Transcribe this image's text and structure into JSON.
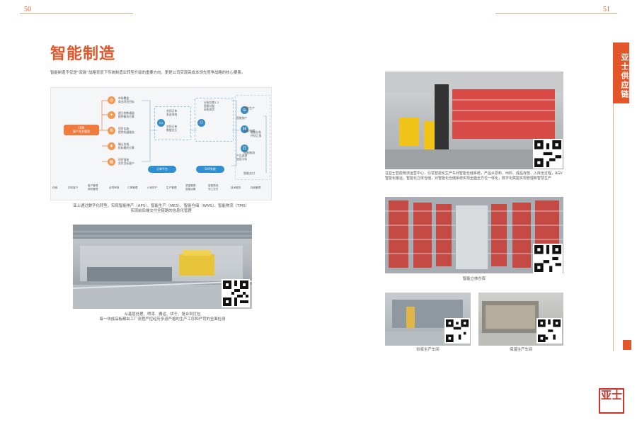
{
  "pages": {
    "left_number": "50",
    "right_number": "51"
  },
  "heading": "智能制造",
  "intro": "智能制造不仅是“双碳”战略背景下传统制造业转型升级的重要方向，更是公司实现高成本领先竞争战略的核心要素。",
  "diagram": {
    "crm": "CRM\n客户关系管理",
    "customer_items": [
      "市场覆盖\n商业项目目标",
      "建立销售通道\n提供解决方案",
      "项目实施\n提供机器服务",
      "确认实施\n投标最终方案",
      "项目落地\n交付目标客户"
    ],
    "middle_items": [
      "分配交期1-2\n智能分配\n采购发货",
      "合同订单\n发送系统",
      "合同订单\n数据交互"
    ],
    "right_items": [
      "智能排产",
      "数据分析\n评估汇报",
      "产品追溯\n加设分析"
    ],
    "outputs": [
      "智能生产",
      "智能仓储",
      "智能物流",
      "智能交付"
    ],
    "pill_left": "订单平台",
    "pill_right": "SAP系统",
    "flow": [
      "线索",
      "初访客户",
      "客户管理\n商机管理",
      "合同审批",
      "订单管理",
      "计划排产",
      "生产管理",
      "质量管理\n智能运输",
      "智能物流\n完工交付",
      "技术服务",
      "持续管理"
    ]
  },
  "diagram_caption": "亚士通过数字化转型，实现智能排产（APS）、智能生产（MES）、智能仓储（WMS）、智能物流（TMS）\n实现前后端交付全链路的信息化管理",
  "left_photo_caption": "从基层处理、喷漆、搬运、烘干、复合到打包\n每一块成品板都由工厂流程严控经历多道严格的生产工序和严苛的全面检测",
  "right_top_caption": "在亚士智能物流运营中心，引进智能化生产车间智能仓储系统，产品从原料、出料、成品存放、入库全过程，AGV智能化搬运，智能化立体仓储，对智能化仓储系统实现全面全方位一体化，数字化赋能实现管理和智慧生产",
  "warehouse_caption": "智能立体仓库",
  "workshop_left": "砂浆生产车间",
  "workshop_right": "保温生产车间",
  "side_tab": "亚士供应链",
  "seal_text": "亚士"
}
